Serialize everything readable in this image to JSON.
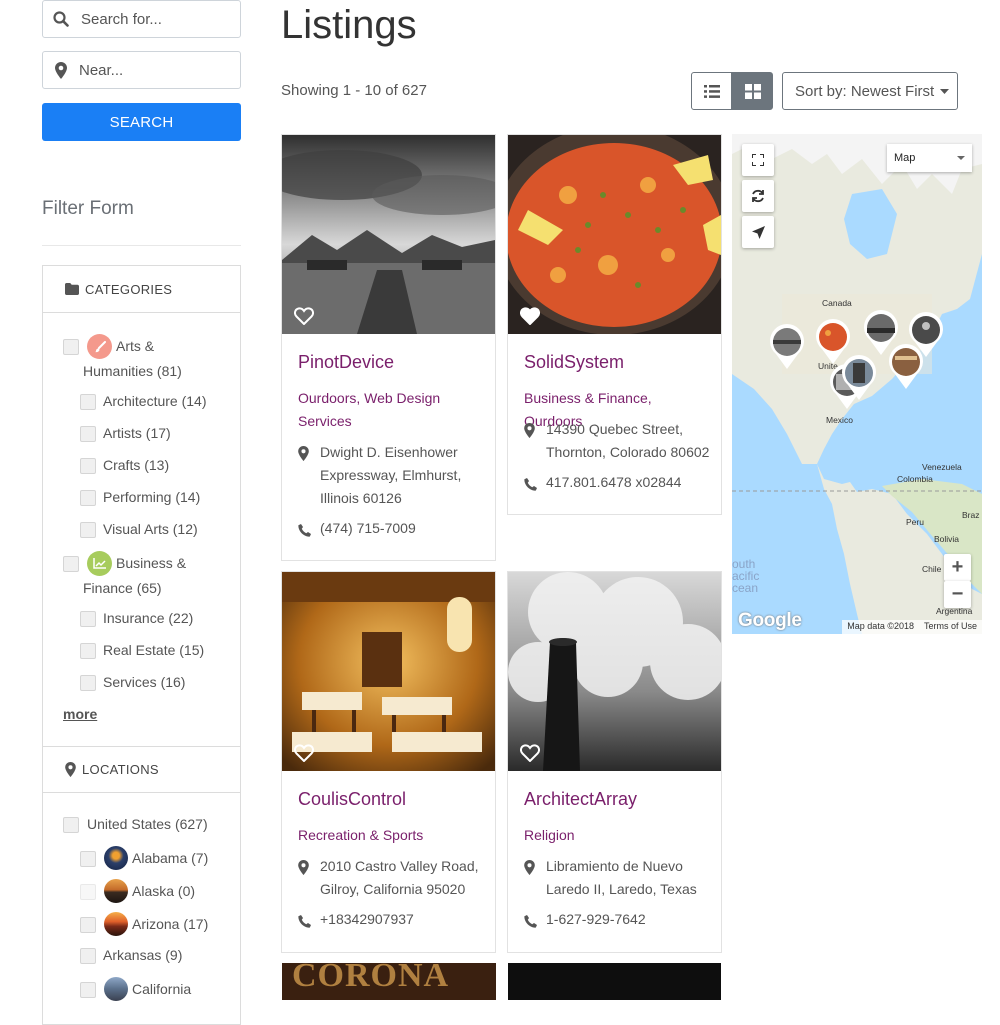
{
  "search": {
    "keyword_placeholder": "Search for...",
    "location_placeholder": "Near...",
    "button_label": "SEARCH"
  },
  "filter": {
    "title": "Filter Form",
    "categories_heading": "CATEGORIES",
    "categories": [
      {
        "label": "Arts &",
        "label2": "Humanities (81)",
        "icon": "paintbrush-icon",
        "color": "#f4998c"
      },
      {
        "label": "Architecture (14)"
      },
      {
        "label": "Artists (17)"
      },
      {
        "label": "Crafts (13)"
      },
      {
        "label": "Performing (14)"
      },
      {
        "label": "Visual Arts (12)"
      },
      {
        "label": "Business &",
        "label2": "Finance (65)",
        "icon": "chart-icon",
        "color": "#a7cc5d"
      },
      {
        "label": "Insurance (22)"
      },
      {
        "label": "Real Estate (15)"
      },
      {
        "label": "Services (16)"
      }
    ],
    "more_label": "more",
    "locations_heading": "LOCATIONS",
    "locations": [
      {
        "label": "United States (627)"
      },
      {
        "label": "Alabama (7)"
      },
      {
        "label": "Alaska (0)"
      },
      {
        "label": "Arizona (17)"
      },
      {
        "label": "Arkansas (9)"
      },
      {
        "label": "California"
      }
    ]
  },
  "main": {
    "title": "Listings",
    "showing": "Showing 1 - 10 of 627",
    "sort_label": "Sort by: Newest First",
    "active_view": "grid",
    "listings": [
      {
        "title": "PinotDevice",
        "category": "Ourdoors, Web Design Services",
        "address": "Dwight D. Eisenhower Expressway, Elmhurst, Illinois 60126",
        "phone": "(474) 715-7009"
      },
      {
        "title": "SolidSystem",
        "category": "Business & Finance, Ourdoors",
        "address": "14390 Quebec Street, Thornton, Colorado 80602",
        "phone": "417.801.6478 x02844"
      },
      {
        "title": "CoulisControl",
        "category": "Recreation & Sports",
        "address": "2010 Castro Valley Road, Gilroy, California 95020",
        "phone": "+18342907937"
      },
      {
        "title": "ArchitectArray",
        "category": "Religion",
        "address": "Libramiento de Nuevo Laredo II, Laredo, Texas",
        "phone": "1-627-929-7642"
      }
    ],
    "next_row_image_text": "CORONA"
  },
  "map": {
    "type_label": "Map",
    "labels": {
      "canada": "Canada",
      "united": "Unite",
      "mexico": "Mexico",
      "venezuela": "Venezuela",
      "colombia": "Colombia",
      "peru": "Peru",
      "bolivia": "Bolivia",
      "chile": "Chile",
      "brazil": "Braz",
      "argentina": "Argentina",
      "ocean1": "outh",
      "ocean2": "acific",
      "ocean3": "cean"
    },
    "google": "Google",
    "data_label": "Map data ©2018",
    "terms_label": "Terms of Use",
    "zoom_in": "+",
    "zoom_out": "−"
  },
  "colors": {
    "accent": "#1a7ff5",
    "listing_title": "#7a1f6b",
    "map_water": "#aadaff",
    "map_land": "#f2efe9"
  }
}
